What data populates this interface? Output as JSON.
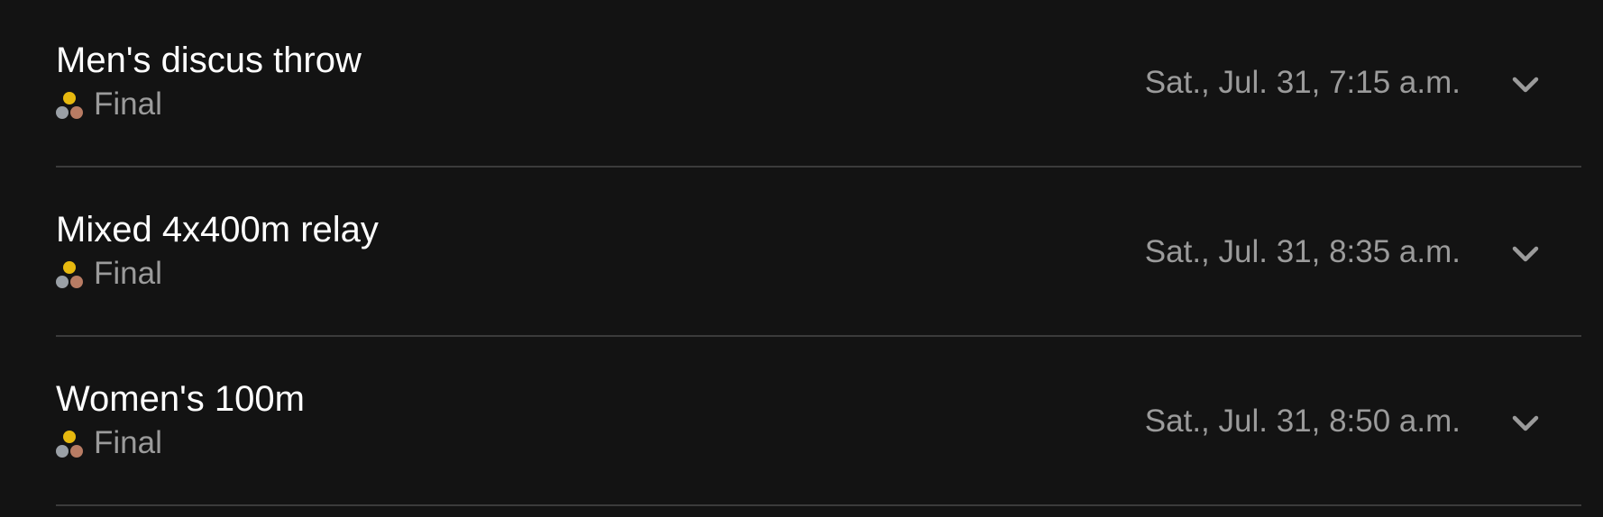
{
  "events": [
    {
      "title": "Men's discus throw",
      "round": "Final",
      "time": "Sat., Jul. 31, 7:15 a.m."
    },
    {
      "title": "Mixed 4x400m relay",
      "round": "Final",
      "time": "Sat., Jul. 31, 8:35 a.m."
    },
    {
      "title": "Women's 100m",
      "round": "Final",
      "time": "Sat., Jul. 31, 8:50 a.m."
    }
  ],
  "icons": {
    "medal_icon": "medals-icon",
    "expand_icon": "chevron-down-icon"
  },
  "colors": {
    "background": "#131313",
    "title_text": "#ffffff",
    "secondary_text": "#9b9b9b",
    "divider": "#3b3b3b",
    "medal_gold": "#e7b90f",
    "medal_silver": "#9aa0a6",
    "medal_bronze": "#b87c64",
    "chevron": "#9b9b9b"
  }
}
